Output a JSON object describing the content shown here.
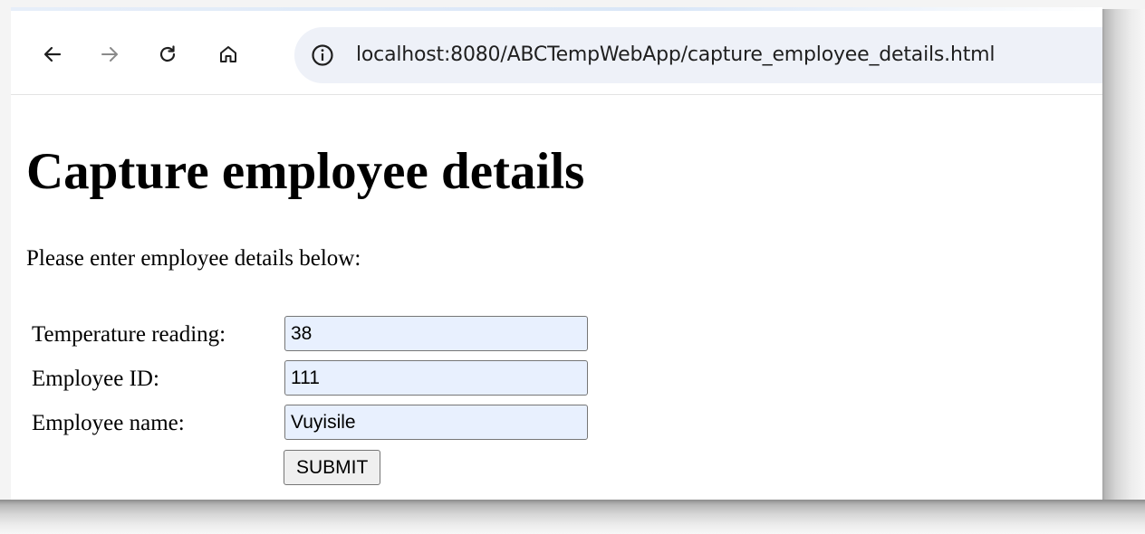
{
  "browser": {
    "url": "localhost:8080/ABCTempWebApp/capture_employee_details.html",
    "nav": {
      "back_icon": "arrow-left-icon",
      "forward_icon": "arrow-right-icon",
      "reload_icon": "reload-icon",
      "home_icon": "home-icon",
      "site_info_icon": "info-circle-icon"
    }
  },
  "page": {
    "title": "Capture employee details",
    "intro": "Please enter employee details below:",
    "form": {
      "temperature": {
        "label": "Temperature reading:",
        "value": "38"
      },
      "employee_id": {
        "label": "Employee ID:",
        "value": "111"
      },
      "employee_name": {
        "label": "Employee name:",
        "value": "Vuyisile"
      },
      "submit_label": "SUBMIT"
    }
  },
  "colors": {
    "autofill_background": "#e8f0fe",
    "omnibox_background": "#eef1f8",
    "button_background": "#efefef"
  }
}
